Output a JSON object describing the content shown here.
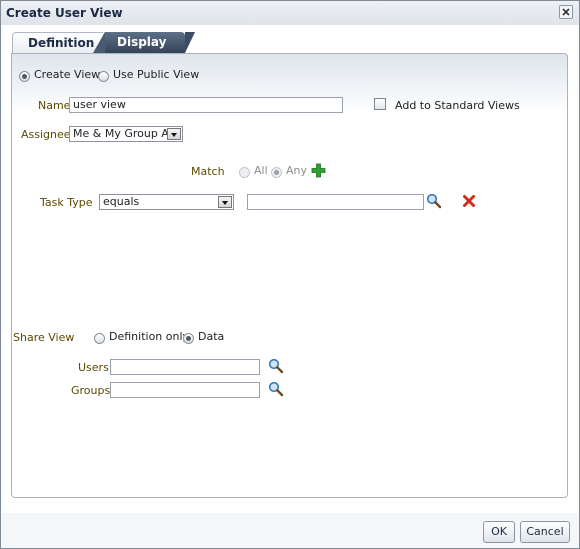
{
  "window": {
    "title": "Create User View",
    "close_icon": "close-icon"
  },
  "tabs": [
    {
      "label": "Definition",
      "active": true
    },
    {
      "label": "Display",
      "active": false
    }
  ],
  "view_type": {
    "create_view_label": "Create View",
    "use_public_view_label": "Use Public View",
    "selected": "Create View"
  },
  "name": {
    "label": "Name",
    "value": "user view"
  },
  "add_to_standard_views": {
    "label": "Add to Standard Views",
    "checked": false
  },
  "assignee": {
    "label": "Assignee",
    "value": "Me & My Group All"
  },
  "match": {
    "label": "Match",
    "all_label": "All",
    "any_label": "Any",
    "selected": "Any",
    "add_icon": "add-icon"
  },
  "task_type": {
    "label": "Task Type",
    "operator": "equals",
    "value": "",
    "search_icon": "search-icon",
    "remove_icon": "delete-icon"
  },
  "share_view": {
    "label": "Share View",
    "definition_only_label": "Definition only",
    "data_label": "Data",
    "selected": "Data"
  },
  "users": {
    "label": "Users",
    "value": ""
  },
  "groups": {
    "label": "Groups",
    "value": ""
  },
  "footer": {
    "ok_label": "OK",
    "cancel_label": "Cancel"
  },
  "colors": {
    "label_text": "#5b4a00",
    "tab_active_text": "#1c2c47",
    "tab_inactive_bg": "#3f4f66",
    "add_icon": "#2fa12f",
    "delete_icon": "#d42a1c",
    "search_icon": "#3a78b8"
  }
}
